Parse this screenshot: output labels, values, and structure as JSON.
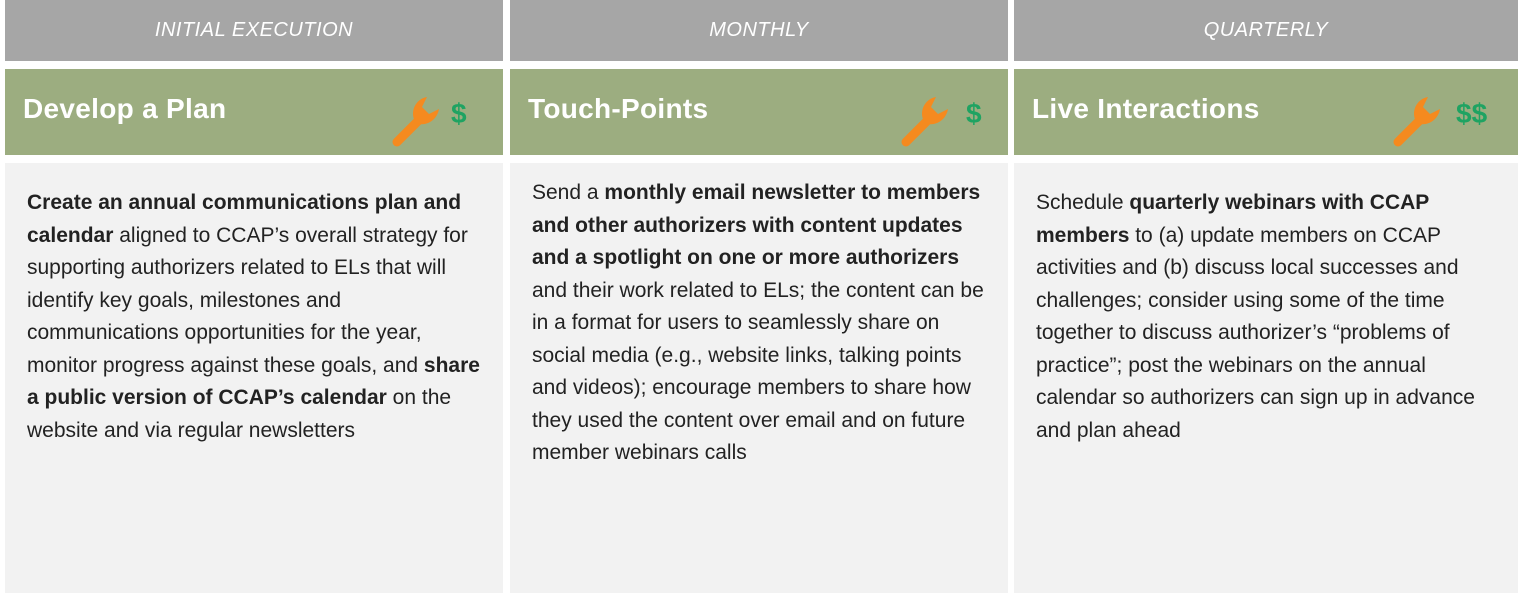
{
  "columns": [
    {
      "frequency": "INITIAL EXECUTION",
      "title": "Develop a Plan",
      "icon": "wrench-icon",
      "cost": "$",
      "description": [
        {
          "text": "Create an annual communications plan and calendar",
          "bold": true
        },
        {
          "text": " aligned to CCAP’s overall strategy for supporting authorizers related to ELs that will identify key goals, milestones and communications opportunities for the year, monitor progress against these goals, and ",
          "bold": false
        },
        {
          "text": "share a public version of CCAP’s calendar",
          "bold": true
        },
        {
          "text": " on the website and via regular newsletters",
          "bold": false
        }
      ]
    },
    {
      "frequency": "MONTHLY",
      "title": "Touch-Points",
      "icon": "wrench-icon",
      "cost": "$",
      "description": [
        {
          "text": "Send a ",
          "bold": false
        },
        {
          "text": "monthly email newsletter to members and other authorizers with content updates and a spotlight on one or more authorizers",
          "bold": true
        },
        {
          "text": " and their work related to ELs; the content can be in a format for users to seamlessly share on social media (e.g., website links, talking points and videos); encourage members to share how they used the content over email and on future member webinars calls",
          "bold": false
        }
      ]
    },
    {
      "frequency": "QUARTERLY",
      "title": "Live Interactions",
      "icon": "wrench-icon",
      "cost": "$$",
      "description": [
        {
          "text": "Schedule ",
          "bold": false
        },
        {
          "text": "quarterly webinars with CCAP members",
          "bold": true
        },
        {
          "text": " to (a) update members on CCAP activities and (b) discuss local successes and challenges; consider using some of the time together to discuss authorizer’s “problems of practice”; post the webinars on the annual calendar so authorizers can sign up in advance and plan ahead",
          "bold": false
        }
      ]
    }
  ],
  "colors": {
    "frequency_band": "#a6a6a6",
    "header_band": "#9cad80",
    "body_panel": "#f2f2f2",
    "wrench": "#f58a1f",
    "cost": "#1fa362"
  }
}
